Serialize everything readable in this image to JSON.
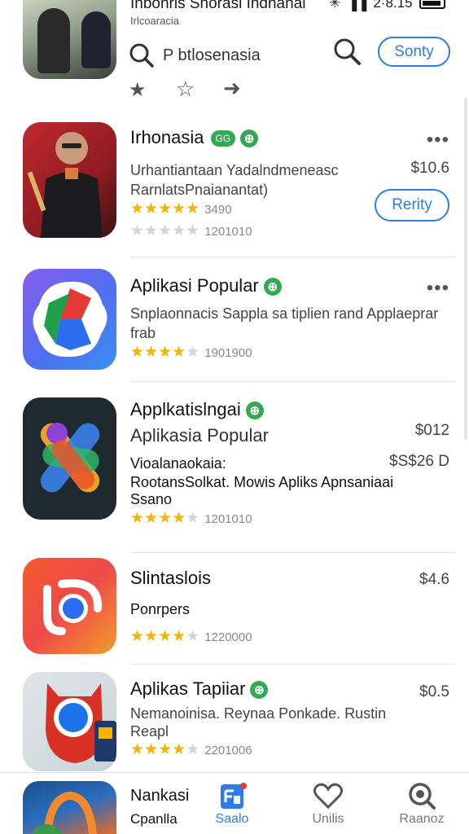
{
  "header": {
    "title": "Inbonris Snorasi Indnanal",
    "subtitle": "Irlcoaracia",
    "status_time": "2·8.15",
    "search_text": "P btlosenasia",
    "sort_label": "Sonty"
  },
  "apps": [
    {
      "name": "Irhonasia",
      "badge": "GG",
      "desc1": "Urhantiantaan Yadalndmeneasc",
      "desc2": "RarnlatsPnaianantat)",
      "price": "$10.6",
      "button": "Rerity",
      "rating": 5,
      "stars_count": "3490",
      "rating2_count": "1201010"
    },
    {
      "name": "Aplikasi Popular",
      "desc1": "Snplaonnacis Sappla sa tiplien rand Applaeprar",
      "desc2": "frab",
      "rating": 4,
      "stars_count": "1901900"
    },
    {
      "name": "Applkatislngai",
      "name2": "Aplikasia Popular",
      "price": "$012",
      "price2": "$S$26 D",
      "desc1": "Vioalanaokaia:",
      "desc2": "RootansSolkat. Mowis Apliks Apnsaniaai",
      "desc3": "Ssano",
      "rating": 4,
      "stars_count": "1201010"
    },
    {
      "name": "Slintaslois",
      "price": "$4.6",
      "desc1": "Ponrpers",
      "rating": 4,
      "stars_count": "1220000"
    },
    {
      "name": "Aplikas Tapiiar",
      "price": "$0.5",
      "desc1": "Nemanoinisa. Reynaa Ponkade. Rustin",
      "desc2": "Reapl",
      "rating": 4,
      "stars_count": "2201006"
    }
  ],
  "peek": {
    "name": "Nankasi",
    "sub": "Cpanlla"
  },
  "bottom_nav": [
    {
      "label": "Saalo",
      "icon": "store-icon",
      "active": true
    },
    {
      "label": "Unilis",
      "icon": "heart-icon",
      "active": false
    },
    {
      "label": "Raanoz",
      "icon": "search-icon",
      "active": false
    }
  ],
  "colors": {
    "accent": "#2b7de9",
    "star": "#f4b400",
    "badge": "#34a853"
  }
}
